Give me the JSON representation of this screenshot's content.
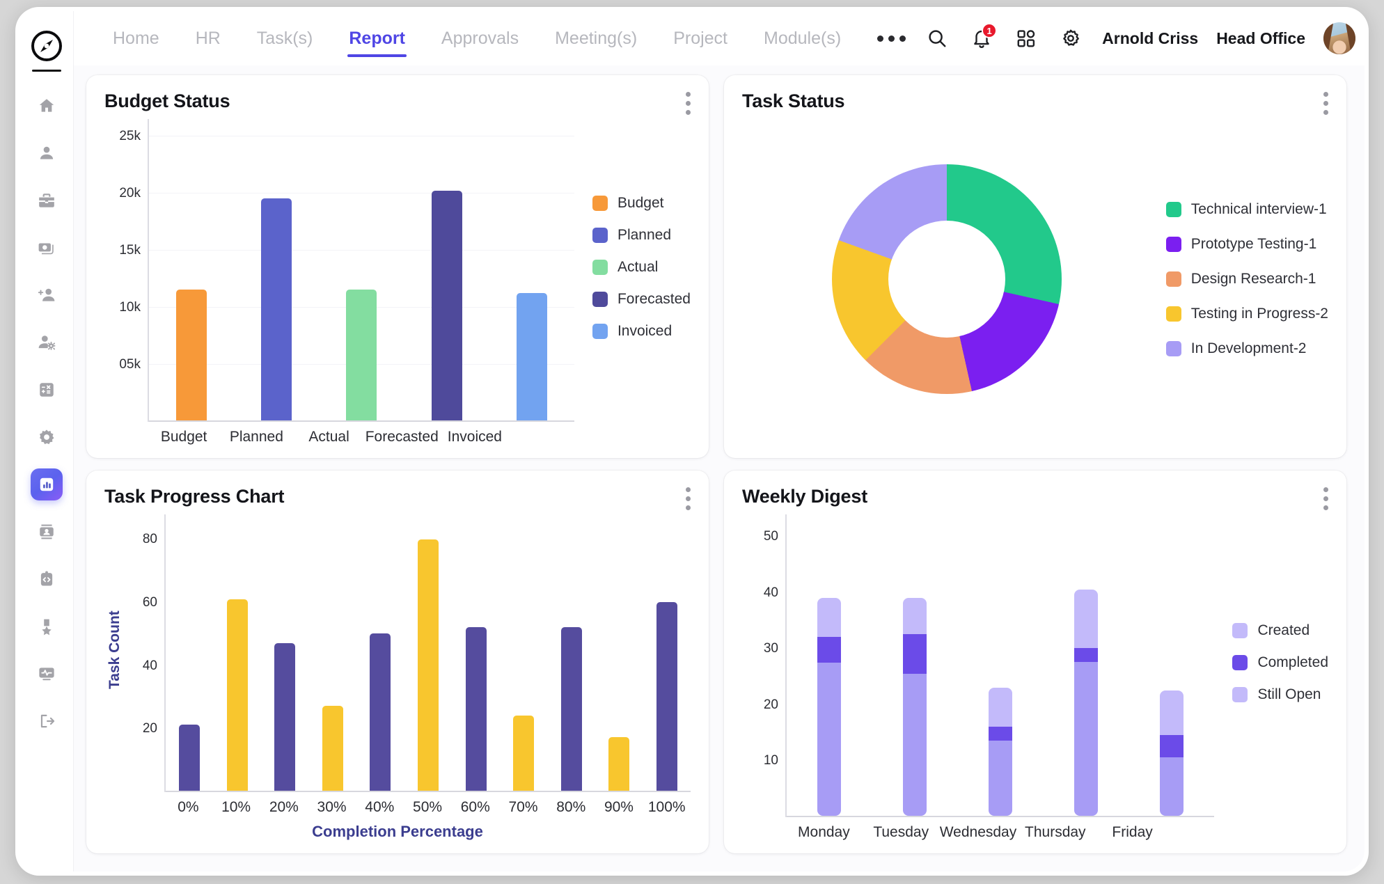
{
  "brand": {
    "logo_icon": "compass-logo"
  },
  "nav": {
    "items": [
      {
        "label": "Home",
        "active": false
      },
      {
        "label": "HR",
        "active": false
      },
      {
        "label": "Task(s)",
        "active": false
      },
      {
        "label": "Report",
        "active": true
      },
      {
        "label": "Approvals",
        "active": false
      },
      {
        "label": "Meeting(s)",
        "active": false
      },
      {
        "label": "Project",
        "active": false
      },
      {
        "label": "Module(s)",
        "active": false
      }
    ],
    "more_icon": "ellipsis-icon"
  },
  "topbar": {
    "search_icon": "search-icon",
    "notification_icon": "bell-icon",
    "notification_count": "1",
    "apps_icon": "grid-apps-icon",
    "settings_icon": "gear-icon",
    "user_name": "Arnold Criss",
    "office_name": "Head Office",
    "avatar": "user-avatar"
  },
  "sidebar": {
    "items": [
      {
        "icon": "home-icon",
        "active": false
      },
      {
        "icon": "person-icon",
        "active": false
      },
      {
        "icon": "briefcase-icon",
        "active": false
      },
      {
        "icon": "payment-card-icon",
        "active": false
      },
      {
        "icon": "add-person-icon",
        "active": false
      },
      {
        "icon": "person-settings-icon",
        "active": false
      },
      {
        "icon": "calculator-icon",
        "active": false
      },
      {
        "icon": "gear-icon",
        "active": false
      },
      {
        "icon": "bar-chart-icon",
        "active": true
      },
      {
        "icon": "contact-card-icon",
        "active": false
      },
      {
        "icon": "code-clipboard-icon",
        "active": false
      },
      {
        "icon": "medal-icon",
        "active": false
      },
      {
        "icon": "monitor-activity-icon",
        "active": false
      },
      {
        "icon": "logout-icon",
        "active": false
      }
    ]
  },
  "cards": {
    "budget": {
      "title": "Budget Status",
      "menu_icon": "kebab-menu-icon"
    },
    "task_status": {
      "title": "Task Status",
      "menu_icon": "kebab-menu-icon"
    },
    "task_progress": {
      "title": "Task Progress Chart",
      "menu_icon": "kebab-menu-icon"
    },
    "weekly_digest": {
      "title": "Weekly Digest",
      "menu_icon": "kebab-menu-icon"
    }
  },
  "chart_data": [
    {
      "id": "budget_status",
      "type": "bar",
      "title": "Budget Status",
      "xlabel": "",
      "ylabel": "",
      "categories": [
        "Budget",
        "Planned",
        "Actual",
        "Forecasted",
        "Invoiced"
      ],
      "values": [
        11500,
        19500,
        11500,
        20200,
        11200
      ],
      "colors": [
        "#F79939",
        "#5B63CB",
        "#83DDA0",
        "#4F4A9B",
        "#72A3F0"
      ],
      "yticks": [
        5000,
        10000,
        15000,
        20000,
        25000
      ],
      "ytick_labels": [
        "05k",
        "10k",
        "15k",
        "20k",
        "25k"
      ],
      "ylim": [
        0,
        26500
      ],
      "grid": true,
      "legend_position": "right",
      "legend": [
        {
          "label": "Budget",
          "color": "#F79939"
        },
        {
          "label": "Planned",
          "color": "#5B63CB"
        },
        {
          "label": "Actual",
          "color": "#83DDA0"
        },
        {
          "label": "Forecasted",
          "color": "#4F4A9B"
        },
        {
          "label": "Invoiced",
          "color": "#72A3F0"
        }
      ]
    },
    {
      "id": "task_status",
      "type": "pie",
      "title": "Task Status",
      "legend_position": "right",
      "slices": [
        {
          "label": "Technical interview-1",
          "value": 28.5,
          "color": "#22C98B"
        },
        {
          "label": "Prototype Testing-1",
          "value": 18.0,
          "color": "#7B1FF0"
        },
        {
          "label": "Design Research-1",
          "value": 16.0,
          "color": "#F09A67"
        },
        {
          "label": "Testing in Progress-2",
          "value": 18.0,
          "color": "#F8C62E"
        },
        {
          "label": "In Development-2",
          "value": 19.5,
          "color": "#A79CF5"
        }
      ]
    },
    {
      "id": "task_progress",
      "type": "bar",
      "title": "Task Progress Chart",
      "xlabel": "Completion Percentage",
      "ylabel": "Task Count",
      "categories": [
        "0%",
        "10%",
        "20%",
        "30%",
        "40%",
        "50%",
        "60%",
        "70%",
        "80%",
        "90%",
        "100%"
      ],
      "values": [
        21,
        61,
        47,
        27,
        50,
        80,
        52,
        24,
        52,
        17,
        60
      ],
      "colors": [
        "#554C9E",
        "#F8C62E",
        "#554C9E",
        "#F8C62E",
        "#554C9E",
        "#F8C62E",
        "#554C9E",
        "#F8C62E",
        "#554C9E",
        "#F8C62E",
        "#554C9E"
      ],
      "yticks": [
        20,
        40,
        60,
        80
      ],
      "ytick_labels": [
        "20",
        "40",
        "60",
        "80"
      ],
      "ylim": [
        0,
        88
      ],
      "grid": false,
      "legend_position": "none"
    },
    {
      "id": "weekly_digest",
      "type": "bar",
      "stacked": true,
      "title": "Weekly Digest",
      "xlabel": "",
      "ylabel": "",
      "categories": [
        "Monday",
        "Tuesday",
        "Wednesday",
        "Thursday",
        "Friday"
      ],
      "series": [
        {
          "name": "Still Open",
          "color": "#A79CF5",
          "values": [
            27.5,
            25.5,
            13.5,
            27.5,
            10.5
          ]
        },
        {
          "name": "Completed",
          "color": "#6B4BE8",
          "values": [
            4.5,
            7.0,
            2.5,
            2.5,
            4.0
          ]
        },
        {
          "name": "Created",
          "color": "#C3BAFA",
          "values": [
            7.0,
            6.5,
            7.0,
            10.5,
            8.0
          ]
        }
      ],
      "yticks": [
        10,
        20,
        30,
        40,
        50
      ],
      "ytick_labels": [
        "10",
        "20",
        "30",
        "40",
        "50"
      ],
      "ylim": [
        0,
        54
      ],
      "grid": false,
      "legend_position": "right",
      "legend": [
        {
          "label": "Created",
          "color": "#C3BAFA"
        },
        {
          "label": "Completed",
          "color": "#6B4BE8"
        },
        {
          "label": "Still Open",
          "color": "#C3BAFA"
        }
      ]
    }
  ]
}
